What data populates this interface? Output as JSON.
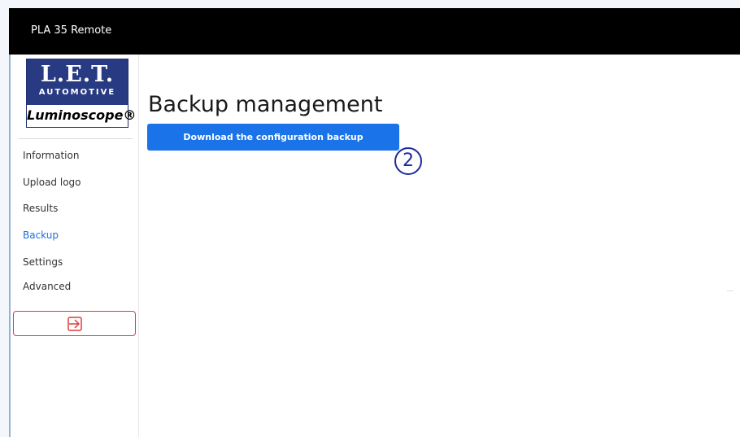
{
  "app": {
    "title": "PLA 35 Remote"
  },
  "logo": {
    "letters": "L.E.T.",
    "subtitle": "AUTOMOTIVE",
    "brand": "Luminoscope®"
  },
  "sidebar": {
    "items": [
      {
        "label": "Information",
        "active": false
      },
      {
        "label": "Upload logo",
        "active": false
      },
      {
        "label": "Results",
        "active": false
      },
      {
        "label": "Backup",
        "active": true
      },
      {
        "label": "Settings",
        "active": false
      },
      {
        "label": "Advanced",
        "active": false
      }
    ],
    "logout_icon": "logout-arrow-icon"
  },
  "main": {
    "title": "Backup management",
    "download_label": "Download the configuration backup",
    "step_marker": "2"
  },
  "colors": {
    "topbar": "#000000",
    "accent": "#1a73e8",
    "active_nav": "#1e6fd9",
    "logout_border": "#e23a3a",
    "logo_blue": "#273a82"
  }
}
